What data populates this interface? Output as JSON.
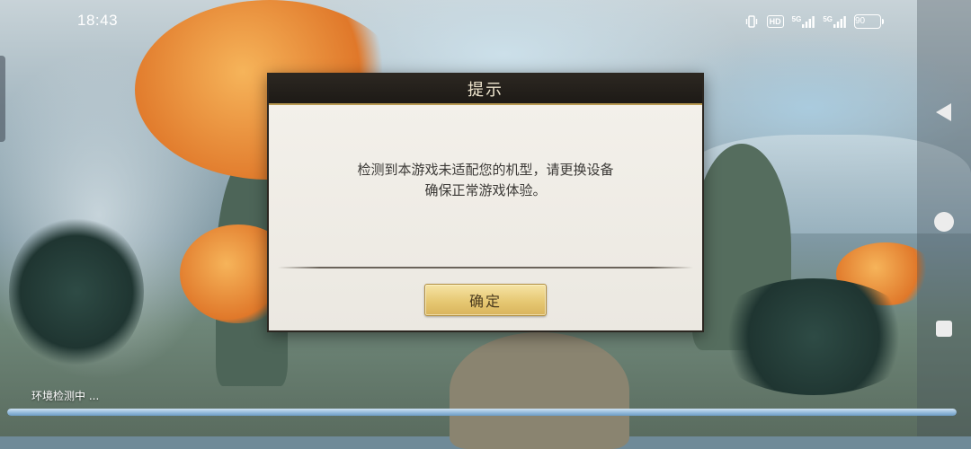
{
  "status_bar": {
    "time": "18:43",
    "icons": [
      "vibrate-icon",
      "hd-badge",
      "signal-5g-icon",
      "signal-5g-icon-2",
      "battery-icon"
    ],
    "hd_label": "HD",
    "network_1": "5G",
    "network_2": "5G",
    "battery_level": "90"
  },
  "dialog": {
    "title": "提示",
    "message_line1": "检测到本游戏未适配您的机型，请更换设备",
    "message_line2": "确保正常游戏体验。",
    "confirm_label": "确定"
  },
  "loading": {
    "status_text": "环境检测中 ...",
    "progress": 1.0
  },
  "nav_bar": {
    "icons": [
      "back-icon",
      "home-icon",
      "recent-apps-icon"
    ]
  },
  "colors": {
    "dialog_header": "#1d1a16",
    "dialog_body": "#f2efe9",
    "button_gold": "#e6c873",
    "progress_blue": "#8fb7d8"
  }
}
